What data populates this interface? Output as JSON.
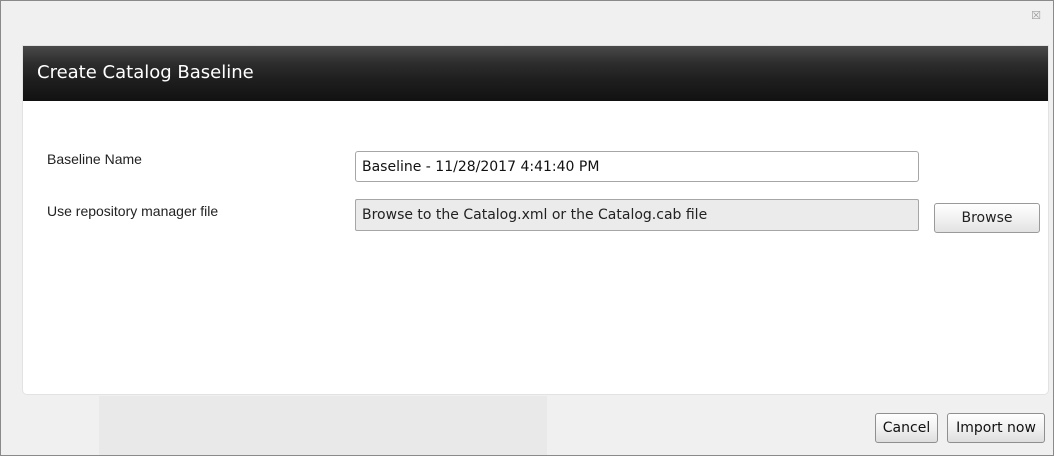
{
  "window": {
    "close_glyph": "☒",
    "close_icon": "close-icon"
  },
  "dialog": {
    "title": "Create Catalog Baseline"
  },
  "form": {
    "baseline_name_label": "Baseline Name",
    "baseline_name_value": "Baseline - 11/28/2017 4:41:40 PM",
    "repo_file_label": "Use repository manager file",
    "repo_file_placeholder": "Browse to the Catalog.xml or the Catalog.cab file",
    "browse_label": "Browse"
  },
  "footer": {
    "cancel_label": "Cancel",
    "import_label": "Import now"
  },
  "colors": {
    "header_bg": "#1f1f1f",
    "header_text": "#ffffff",
    "window_bg": "#f0f0f0",
    "panel_bg": "#ffffff",
    "readonly_input_bg": "#ebebeb"
  }
}
